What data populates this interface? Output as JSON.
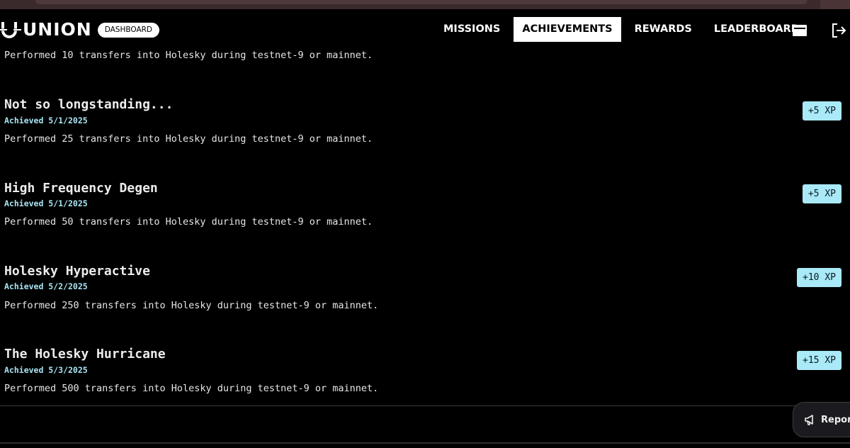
{
  "header": {
    "logo_text": "UNION",
    "badge": "DASHBOARD",
    "nav": [
      {
        "label": "MISSIONS",
        "active": false
      },
      {
        "label": "ACHIEVEMENTS",
        "active": true
      },
      {
        "label": "REWARDS",
        "active": false
      },
      {
        "label": "LEADERBOARD",
        "active": false
      }
    ],
    "icons": [
      "inbox-icon",
      "logout-icon"
    ]
  },
  "achievements": {
    "first_partial_description": "Performed 10 transfers into Holesky during testnet-9 or mainnet.",
    "items": [
      {
        "title": "Not so longstanding...",
        "date": "Achieved 5/1/2025",
        "description": "Performed 25 transfers into Holesky during testnet-9 or mainnet.",
        "xp": "+5 XP"
      },
      {
        "title": "High Frequency Degen",
        "date": "Achieved 5/1/2025",
        "description": "Performed 50 transfers into Holesky during testnet-9 or mainnet.",
        "xp": "+5 XP"
      },
      {
        "title": "Holesky Hyperactive",
        "date": "Achieved 5/2/2025",
        "description": "Performed 250 transfers into Holesky during testnet-9 or mainnet.",
        "xp": "+10 XP"
      },
      {
        "title": "The Holesky Hurricane",
        "date": "Achieved 5/3/2025",
        "description": "Performed 500 transfers into Holesky during testnet-9 or mainnet.",
        "xp": "+15 XP"
      }
    ]
  },
  "report_button": {
    "label": "Report"
  },
  "colors": {
    "background": "#000000",
    "accent_badge": "#a9e9f8",
    "date_text": "#a9e7f5"
  }
}
